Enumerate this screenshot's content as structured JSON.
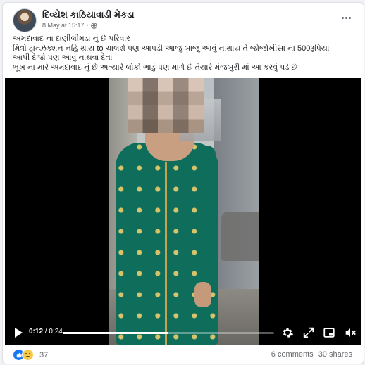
{
  "post": {
    "author": "દિવ્યેશ કાઠિયાવાડી મેકડા",
    "timestamp": "8 May at 15:17",
    "privacy_separator": "·",
    "text_lines": [
      "અમદાવાદ ના દાણીલીમડા નું છે પરિવાર",
      "મિત્રો ટ્રાન્ઝેક્શન નહિ થાય to ચાલશે પણ આપડી આજુ બાજુ આવું નાથાય તે જોજોખીસા ના 500રૂપિયા",
      "આપી દેજો પણ આવું નાથવા દેતા",
      "ભૂખ ના મારે અમદાવાદ નું છે અત્યારે લોકો ભાડું પણ માગે છે તૈયારે મંજબુરી માં આ કરવું પડે છે"
    ]
  },
  "video": {
    "current_time": "0:12",
    "separator": " / ",
    "duration": "0:24",
    "progress_fraction": 0.5
  },
  "footer": {
    "reaction_count": "37",
    "comments": "6 comments",
    "shares": "30 shares"
  },
  "icons": {
    "globe": "globe-icon",
    "more": "more-options-icon",
    "play": "play-icon",
    "settings": "gear-icon",
    "expand": "expand-icon",
    "pip": "picture-in-picture-icon",
    "volume": "volume-muted-icon"
  },
  "colors": {
    "like_blue": "#1877f2",
    "text_primary": "#1c1e21",
    "text_secondary": "#65676b",
    "dress_green": "#0f6d5c"
  }
}
